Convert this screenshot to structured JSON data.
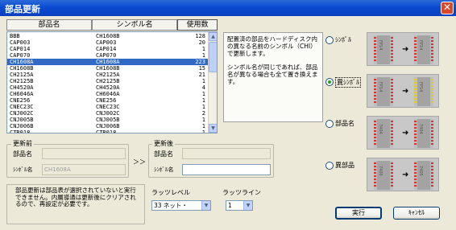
{
  "window": {
    "title": "部品更新",
    "close": "✕"
  },
  "list": {
    "headers": {
      "part": "部品名",
      "symbol": "シンボル名",
      "count": "使用数"
    },
    "rows": [
      [
        "BBB",
        "CH1608B",
        "128"
      ],
      [
        "CAP003",
        "CAP003",
        "20"
      ],
      [
        "CAP014",
        "CAP014",
        "1"
      ],
      [
        "CAP070",
        "CAP070",
        "1"
      ],
      [
        "CH1608A",
        "CH1608A",
        "223"
      ],
      [
        "CH1608B",
        "CH1608B",
        "15"
      ],
      [
        "CH2125A",
        "CH2125A",
        "21"
      ],
      [
        "CH2125B",
        "CH2125B",
        "1"
      ],
      [
        "CH4520A",
        "CH4520A",
        "4"
      ],
      [
        "CH6046A",
        "CH6046A",
        "1"
      ],
      [
        "CNE256",
        "CNE256",
        "1"
      ],
      [
        "CNEC23C",
        "CNEC23C",
        "1"
      ],
      [
        "CNJ002C",
        "CNJ002C",
        "2"
      ],
      [
        "CNJ005B",
        "CNJ005B",
        "1"
      ],
      [
        "CNJ006B",
        "CNJ006B",
        "1"
      ],
      [
        "CTR018",
        "CTR018",
        "1"
      ]
    ],
    "selected_index": 4
  },
  "description": {
    "p1": "配置済の部品をハードディスク内の異なる名前のシンボル（CHI）で更新します。",
    "p2": "シンボル名が同じであれば、部品名が異なる場合も全て置き換えます。"
  },
  "before": {
    "title": "更新前",
    "part_label": "部品名",
    "part_value": "",
    "symbol_label": "ｼﾝﾎﾞﾙ名",
    "symbol_value": "CH1608A"
  },
  "after": {
    "title": "更新後",
    "part_label": "部品名",
    "part_value": "",
    "symbol_label": "ｼﾝﾎﾞﾙ名",
    "symbol_value": ""
  },
  "arrow": "＞＞",
  "note": "部品更新は部品表が選択されていないと実行できません。内層導通は更新後にクリアされるので、再設定が必要です。",
  "rats": {
    "level_label": "ラッツレベル",
    "level_value": "33 ネット・",
    "line_label": "ラッツライン",
    "line_value": "1"
  },
  "options": [
    {
      "label": "ｼﾝﾎﾞﾙ",
      "checked": false,
      "left": "FP14",
      "right": "FP14"
    },
    {
      "label": "異ｼﾝﾎﾞﾙ",
      "checked": true,
      "left": "FP14",
      "right": "FP14"
    },
    {
      "label": "部品名",
      "checked": false,
      "left": "7404",
      "right": "7404"
    },
    {
      "label": "異部品",
      "checked": false,
      "left": "7400",
      "right": "7405"
    }
  ],
  "buttons": {
    "ok": "実行",
    "cancel": "ｷｬﾝｾﾙ"
  },
  "colors": {
    "title_bar": "#0a4bd0",
    "selection": "#316ac5",
    "pin_red": "#e03030",
    "pin_yellow": "#e0d020"
  }
}
